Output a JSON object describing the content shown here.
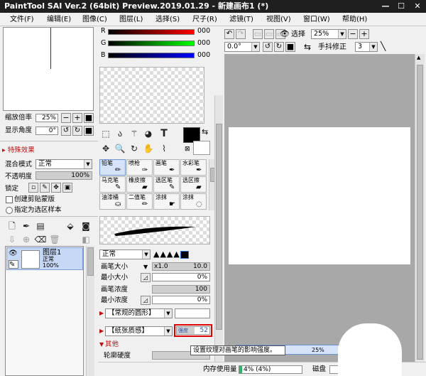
{
  "window": {
    "title": "PaintTool SAI Ver.2 (64bit) Preview.2019.01.29 - 新建画布1 (*)",
    "min_glyph": "—",
    "max_glyph": "☐",
    "close_glyph": "✕"
  },
  "menu": [
    "文件(F)",
    "编辑(E)",
    "图像(C)",
    "图层(L)",
    "选择(S)",
    "尺子(R)",
    "滤镜(T)",
    "视图(V)",
    "窗口(W)",
    "帮助(H)"
  ],
  "navigator": {
    "zoom_label": "缩放倍率",
    "zoom_value": "25%",
    "angle_label": "显示角度",
    "angle_value": "0°"
  },
  "special_effects": {
    "header": "特殊效果"
  },
  "layer_props": {
    "blend_label": "混合模式",
    "blend_value": "正常",
    "opacity_label": "不透明度",
    "opacity_value": "100%",
    "lock_label": "锁定",
    "clip_label": "创建剪贴蒙版",
    "ref_label": "指定为选区样本"
  },
  "layer": {
    "name": "图层1",
    "mode": "正常",
    "opacity": "100%"
  },
  "color": {
    "channels": [
      {
        "label": "R",
        "value": "000",
        "gradient_to": "#ff0000"
      },
      {
        "label": "G",
        "value": "000",
        "gradient_to": "#00ff00"
      },
      {
        "label": "B",
        "value": "000",
        "gradient_to": "#0000ff"
      }
    ],
    "primary": "#000000",
    "secondary": "#ffffff"
  },
  "brushes": [
    {
      "name": "铅笔",
      "icon": "pencil-icon"
    },
    {
      "name": "喷枪",
      "icon": "airbrush-icon"
    },
    {
      "name": "画笔",
      "icon": "brush-icon"
    },
    {
      "name": "水彩笔",
      "icon": "watercolor-icon"
    },
    {
      "name": "马克笔",
      "icon": "marker-icon"
    },
    {
      "name": "橡皮擦",
      "icon": "eraser-icon"
    },
    {
      "name": "选区笔",
      "icon": "select-pen-icon"
    },
    {
      "name": "选区擦",
      "icon": "select-eraser-icon"
    },
    {
      "name": "油漆桶",
      "icon": "bucket-icon"
    },
    {
      "name": "二值笔",
      "icon": "binary-pen-icon"
    },
    {
      "name": "涂抹",
      "icon": "smudge-icon"
    },
    {
      "name": "涂抹",
      "icon": "blur-icon"
    }
  ],
  "brush_settings": {
    "mode": "正常",
    "size_label": "画笔大小",
    "size_mult": "x1.0",
    "size_value": "10.0",
    "min_size_label": "最小大小",
    "min_size_value": "0%",
    "density_label": "画笔浓度",
    "density_value": "100",
    "min_density_label": "最小浓度",
    "min_density_value": "0%",
    "shape": "【常规的圆形】",
    "texture": "【纸张质感】",
    "strength_label": "强度",
    "strength_value": "52",
    "other_label": "其他",
    "hardness_label": "轮廓硬度"
  },
  "canvas_toolbar": {
    "select_label": "选择",
    "zoom_value": "25%",
    "angle_value": "0.0°",
    "stabilizer_label": "手抖修正",
    "stabilizer_value": "3"
  },
  "tooltip": "设置纹理对画笔的影响强度。",
  "statusbar": {
    "memory_label": "内存使用量",
    "memory_value": "4% (4%)",
    "disk_label": "磁盘",
    "canvas_tab_zoom": "25%"
  }
}
